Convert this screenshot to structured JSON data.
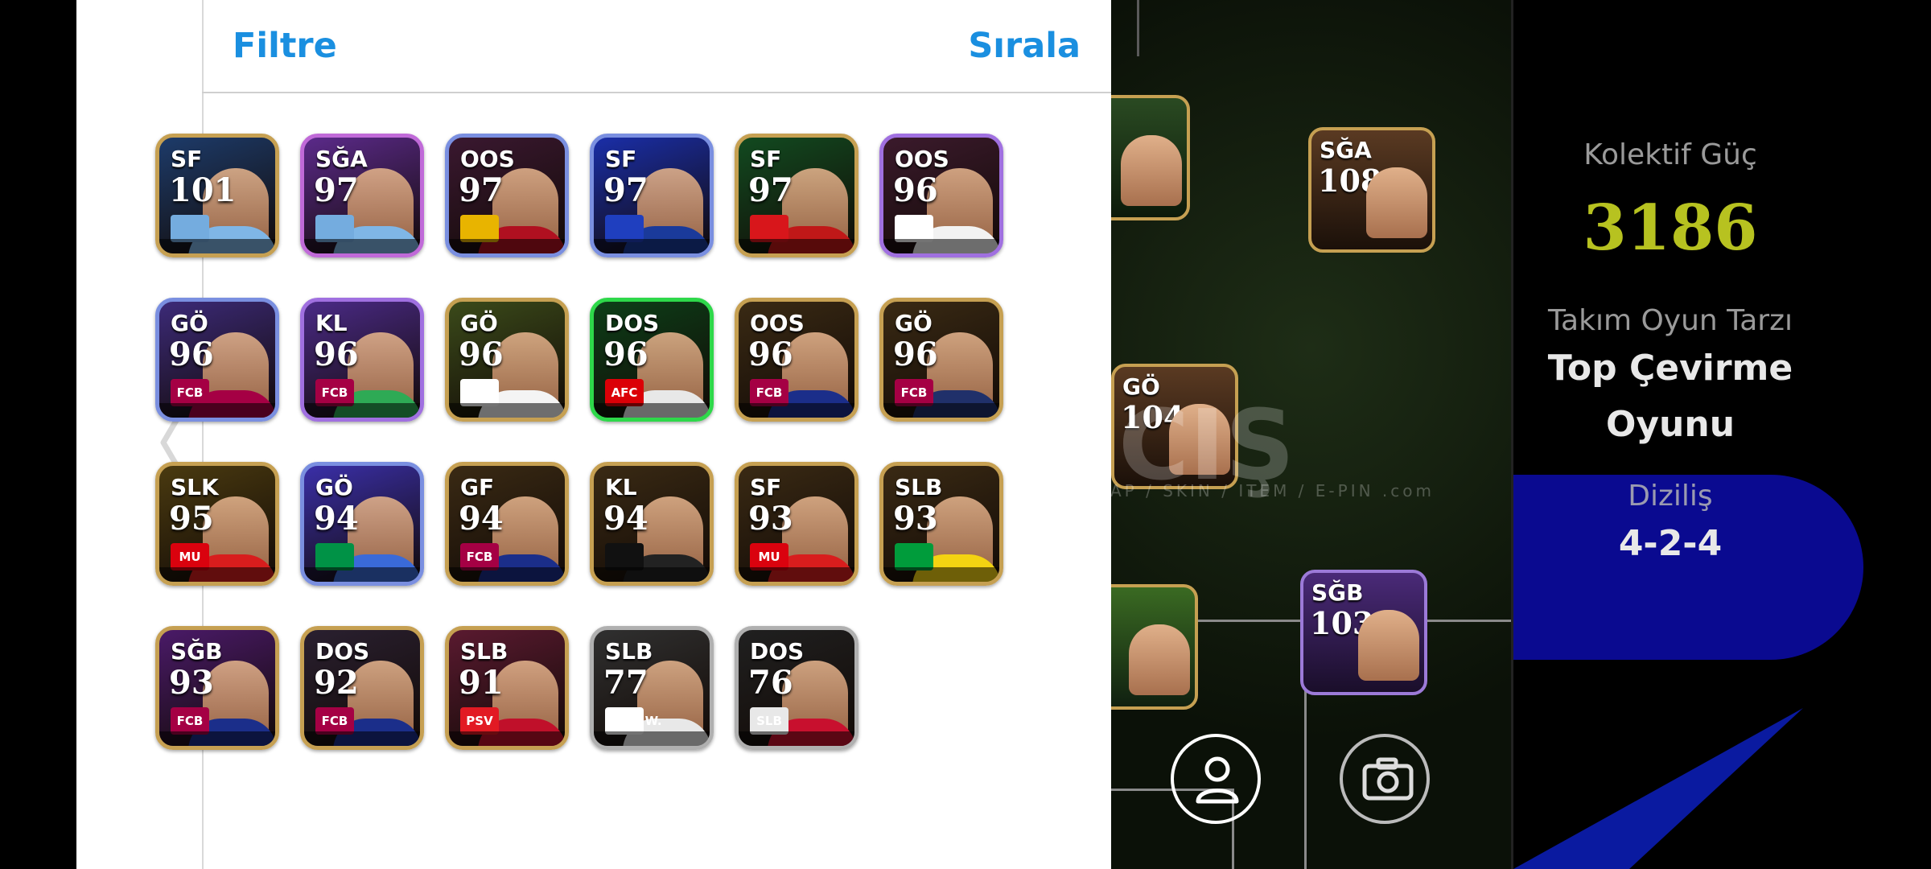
{
  "panel": {
    "filter_label": "Filtre",
    "sort_label": "Sırala"
  },
  "cards": [
    {
      "pos": "SF",
      "rating": "101",
      "bg": "#1d3b6a",
      "shirt": "#7fb6e6",
      "badge": "",
      "badgeBg": "#74acdf",
      "border": "#c6a052"
    },
    {
      "pos": "SĞA",
      "rating": "97",
      "bg": "#5b2a8a",
      "shirt": "#7fb6e6",
      "badge": "",
      "badgeBg": "#74acdf",
      "border": "#c06ad8"
    },
    {
      "pos": "OOS",
      "rating": "97",
      "bg": "#3a1830",
      "shirt": "#b01020",
      "badge": "",
      "badgeBg": "#e8b400",
      "border": "#7a8fe0"
    },
    {
      "pos": "SF",
      "rating": "97",
      "bg": "#1a2ea8",
      "shirt": "#1a3a9a",
      "badge": "",
      "badgeBg": "#1f3fbf",
      "border": "#7a8fe0"
    },
    {
      "pos": "SF",
      "rating": "97",
      "bg": "#124a20",
      "shirt": "#c01818",
      "badge": "",
      "badgeBg": "#d8161b",
      "border": "#c6a052"
    },
    {
      "pos": "OOS",
      "rating": "96",
      "bg": "#3b1a2c",
      "shirt": "#f2f2f2",
      "badge": "",
      "badgeBg": "#ffffff",
      "border": "#a070e0"
    },
    {
      "pos": "GÖ",
      "rating": "96",
      "bg": "#3c2a78",
      "shirt": "#a50044",
      "badge": "FCB",
      "badgeBg": "#a50044",
      "border": "#7a8fe0"
    },
    {
      "pos": "KL",
      "rating": "96",
      "bg": "#4a2a86",
      "shirt": "#2eaa55",
      "badge": "FCB",
      "badgeBg": "#a50044",
      "border": "#a070e0"
    },
    {
      "pos": "GÖ",
      "rating": "96",
      "bg": "#3b4a1a",
      "shirt": "#f4f4f4",
      "badge": "",
      "badgeBg": "#ffffff",
      "border": "#c6a052"
    },
    {
      "pos": "DOS",
      "rating": "96",
      "bg": "#0d3e18",
      "shirt": "#e8e8e8",
      "badge": "AFC",
      "badgeBg": "#db0007",
      "border": "#2ed84a"
    },
    {
      "pos": "OOS",
      "rating": "96",
      "bg": "#3a2a14",
      "shirt": "#1b2e8a",
      "badge": "FCB",
      "badgeBg": "#a50044",
      "border": "#c6a052"
    },
    {
      "pos": "GÖ",
      "rating": "96",
      "bg": "#3a2a14",
      "shirt": "#20306a",
      "badge": "FCB",
      "badgeBg": "#a50044",
      "border": "#c6a052"
    },
    {
      "pos": "SLK",
      "rating": "95",
      "bg": "#4a3a10",
      "shirt": "#d81d1d",
      "badge": "MU",
      "badgeBg": "#da020e",
      "border": "#c6a052"
    },
    {
      "pos": "GÖ",
      "rating": "94",
      "bg": "#3a2fa8",
      "shirt": "#3a6ad8",
      "badge": "",
      "badgeBg": "#009246",
      "border": "#7a8fe0"
    },
    {
      "pos": "GF",
      "rating": "94",
      "bg": "#3a2a14",
      "shirt": "#1b2e8a",
      "badge": "FCB",
      "badgeBg": "#a50044",
      "border": "#c6a052"
    },
    {
      "pos": "KL",
      "rating": "94",
      "bg": "#3a2a14",
      "shirt": "#222222",
      "badge": "",
      "badgeBg": "#111111",
      "border": "#c6a052"
    },
    {
      "pos": "SF",
      "rating": "93",
      "bg": "#3a2a14",
      "shirt": "#d81d1d",
      "badge": "MU",
      "badgeBg": "#da020e",
      "border": "#c6a052"
    },
    {
      "pos": "SLB",
      "rating": "93",
      "bg": "#3a2a14",
      "shirt": "#f3d312",
      "badge": "",
      "badgeBg": "#009c3b",
      "border": "#c6a052"
    },
    {
      "pos": "SĞB",
      "rating": "93",
      "bg": "#4a1a68",
      "shirt": "#1b2e8a",
      "badge": "FCB",
      "badgeBg": "#a50044",
      "border": "#c6a052"
    },
    {
      "pos": "DOS",
      "rating": "92",
      "bg": "#2a2030",
      "shirt": "#1b2e8a",
      "badge": "FCB",
      "badgeBg": "#a50044",
      "border": "#c6a052"
    },
    {
      "pos": "SLB",
      "rating": "91",
      "bg": "#5a1a30",
      "shirt": "#c0102a",
      "badge": "PSV",
      "badgeBg": "#e21a23",
      "border": "#c6a052"
    },
    {
      "pos": "SLB",
      "rating": "77",
      "bg": "#303030",
      "shirt": "#e8e8e8",
      "badge": "MD.S.W.",
      "badgeBg": "#ffffff",
      "border": "#b0b0b0"
    },
    {
      "pos": "DOS",
      "rating": "76",
      "bg": "#202020",
      "shirt": "#c8102e",
      "badge": "SLB",
      "badgeBg": "#e8e8e8",
      "border": "#b0b0b0"
    }
  ],
  "field": {
    "watermark": "CIŞ",
    "watermark_sub": "AP / SKIN / ITEM / E-PIN .com",
    "players": [
      {
        "pos": "SĞA",
        "rating": "108",
        "border": "#c6a052"
      },
      {
        "pos": "GÖ",
        "rating": "104",
        "border": "#c6a052"
      },
      {
        "pos": "SĞB",
        "rating": "103",
        "border": "#9c7ad8"
      }
    ]
  },
  "info": {
    "power_label": "Kolektif Güç",
    "power_value": "3186",
    "style_label": "Takım Oyun Tarzı",
    "style_line1": "Top Çevirme",
    "style_line2": "Oyunu",
    "formation_label": "Diziliş",
    "formation_value": "4-2-4"
  },
  "colors": {
    "accent": "#1a8fe0",
    "power": "#b7c220",
    "formation_blob": "#0a0a90"
  }
}
